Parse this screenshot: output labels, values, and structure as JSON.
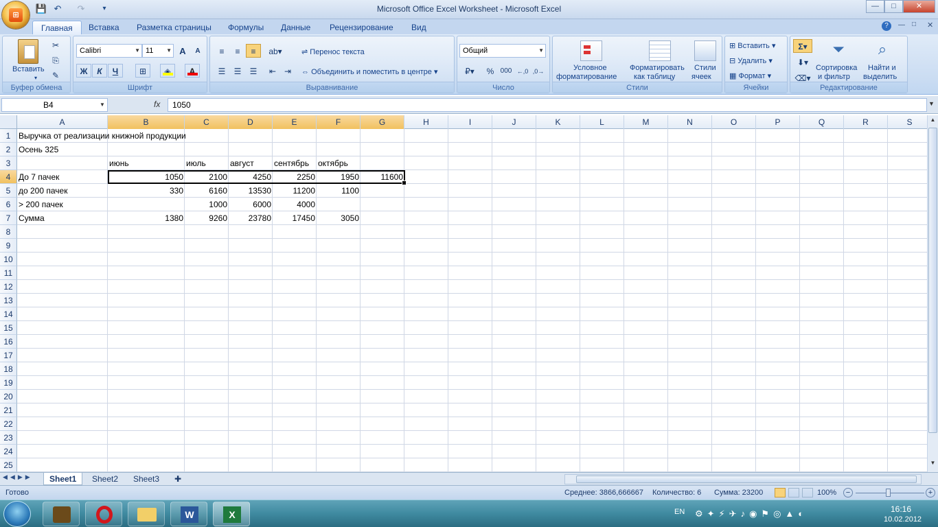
{
  "window": {
    "title": "Microsoft Office Excel Worksheet - Microsoft Excel",
    "minimize": "—",
    "maximize": "□",
    "close": "✕"
  },
  "qat": {
    "save": "💾",
    "undo": "↶",
    "redo": "↷",
    "customize": "▾"
  },
  "tabs": [
    "Главная",
    "Вставка",
    "Разметка страницы",
    "Формулы",
    "Данные",
    "Рецензирование",
    "Вид"
  ],
  "ribbon": {
    "clipboard": {
      "caption": "Буфер обмена",
      "paste": "Вставить"
    },
    "font": {
      "caption": "Шрифт",
      "name": "Calibri",
      "size": "11",
      "grow": "A",
      "shrink": "A",
      "bold": "Ж",
      "italic": "К",
      "underline": "Ч",
      "font_color": "A"
    },
    "alignment": {
      "caption": "Выравнивание",
      "wrap": "Перенос текста",
      "merge": "Объединить и поместить в центре"
    },
    "number": {
      "caption": "Число",
      "format": "Общий",
      "percent": "%",
      "thousands": "000",
      "inc_dec": ",0\n,00",
      "dec_dec": ",00\n,0"
    },
    "styles": {
      "caption": "Стили",
      "conditional": "Условное\nформатирование",
      "conditional_l1": "Условное",
      "conditional_l2": "форматирование",
      "table_l1": "Форматировать",
      "table_l2": "как таблицу",
      "cell_l1": "Стили",
      "cell_l2": "ячеек"
    },
    "cells": {
      "caption": "Ячейки",
      "insert": "Вставить",
      "delete": "Удалить",
      "format": "Формат"
    },
    "editing": {
      "caption": "Редактирование",
      "sort_l1": "Сортировка",
      "sort_l2": "и фильтр",
      "find_l1": "Найти и",
      "find_l2": "выделить"
    }
  },
  "formula_bar": {
    "name_box": "B4",
    "fx": "fx",
    "value": "1050"
  },
  "columns": [
    "A",
    "B",
    "C",
    "D",
    "E",
    "F",
    "G",
    "H",
    "I",
    "J",
    "K",
    "L",
    "M",
    "N",
    "O",
    "P",
    "Q",
    "R",
    "S"
  ],
  "rows": [
    "1",
    "2",
    "3",
    "4",
    "5",
    "6",
    "7",
    "8",
    "9",
    "10",
    "11",
    "12",
    "13",
    "14",
    "15",
    "16",
    "17",
    "18",
    "19",
    "20",
    "21",
    "22",
    "23",
    "24",
    "25"
  ],
  "cells": {
    "A1": "Выручка от реализации книжной продукции",
    "A2": "Осень 325",
    "B3": "июнь",
    "C3": "июль",
    "D3": "август",
    "E3": "сентябрь",
    "F3": "октябрь",
    "A4": "До 7 пачек",
    "B4": "1050",
    "C4": "2100",
    "D4": "4250",
    "E4": "2250",
    "F4": "1950",
    "G4": "11600",
    "A5": "до 200 пачек",
    "B5": "330",
    "C5": "6160",
    "D5": "13530",
    "E5": "11200",
    "F5": "1100",
    "A6": "> 200 пачек",
    "C6": "1000",
    "D6": "6000",
    "E6": "4000",
    "A7": "Сумма",
    "B7": "1380",
    "C7": "9260",
    "D7": "23780",
    "E7": "17450",
    "F7": "3050"
  },
  "sheets": [
    "Sheet1",
    "Sheet2",
    "Sheet3"
  ],
  "status": {
    "ready": "Готово",
    "average": "Среднее: 3866,666667",
    "count": "Количество: 6",
    "sum": "Сумма: 23200",
    "zoom": "100%"
  },
  "taskbar": {
    "lang": "EN",
    "time": "16:16",
    "date": "10.02.2012"
  }
}
